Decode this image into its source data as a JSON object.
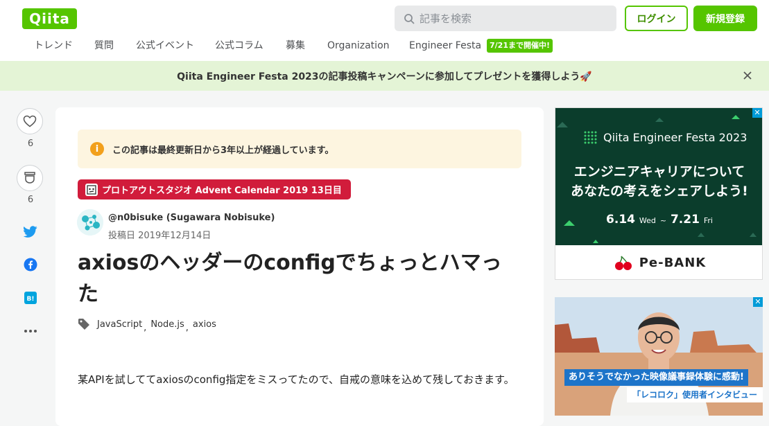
{
  "header": {
    "logo": "Qiita",
    "search_placeholder": "記事を検索",
    "login_label": "ログイン",
    "signup_label": "新規登録",
    "nav": [
      "トレンド",
      "質問",
      "公式イベント",
      "公式コラム",
      "募集",
      "Organization",
      "Engineer Festa"
    ],
    "nav_badge": "7/21まで開催中!"
  },
  "banner": {
    "text": "Qiita Engineer Festa 2023の記事投稿キャンペーンに参加してプレゼントを獲得しよう🚀"
  },
  "sidebar": {
    "like_count": "6",
    "stock_count": "6"
  },
  "article": {
    "notice": "この記事は最終更新日から3年以上が経過しています。",
    "calendar_label": "プロトアウトスタジオ Advent Calendar 2019 13日目",
    "author": "@n0bisuke (Sugawara Nobisuke)",
    "posted": "投稿日 2019年12月14日",
    "title": "axiosのヘッダーのconfigでちょっとハマった",
    "tags": [
      "JavaScript",
      "Node.js",
      "axios"
    ],
    "body": "某APIを試しててaxiosのconfig指定をミスってたので、自戒の意味を込めて残しておきます。"
  },
  "ads": {
    "ad1": {
      "event_name": "Qiita Engineer Festa 2023",
      "headline_1": "エンジニアキャリアについて",
      "headline_2": "あなたの考えをシェアしよう!",
      "date_start": "6.14",
      "date_start_day": "Wed",
      "date_sep": "~",
      "date_end": "7.21",
      "date_end_day": "Fri",
      "sponsor": "Pe-BANK"
    },
    "ad2": {
      "caption_1": "ありそうでなかった映像議事録体験に感動!",
      "caption_2": "「レコロク」使用者インタビュー"
    }
  }
}
